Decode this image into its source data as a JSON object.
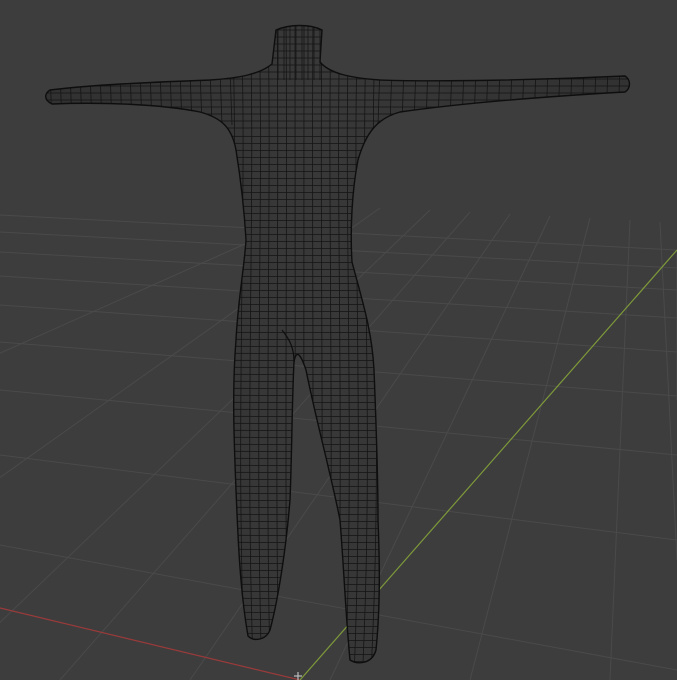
{
  "viewport": {
    "background": "#3d3d3d",
    "grid_color": "#4a4a4a",
    "x_axis_color": "#9a3a3a",
    "y_axis_color": "#7e9a3a"
  },
  "mesh": {
    "fill": "#363636",
    "wire": "#151515",
    "shading": "#2c2c2c"
  },
  "gizmos": {
    "origin_icon": "object-origin-icon"
  }
}
